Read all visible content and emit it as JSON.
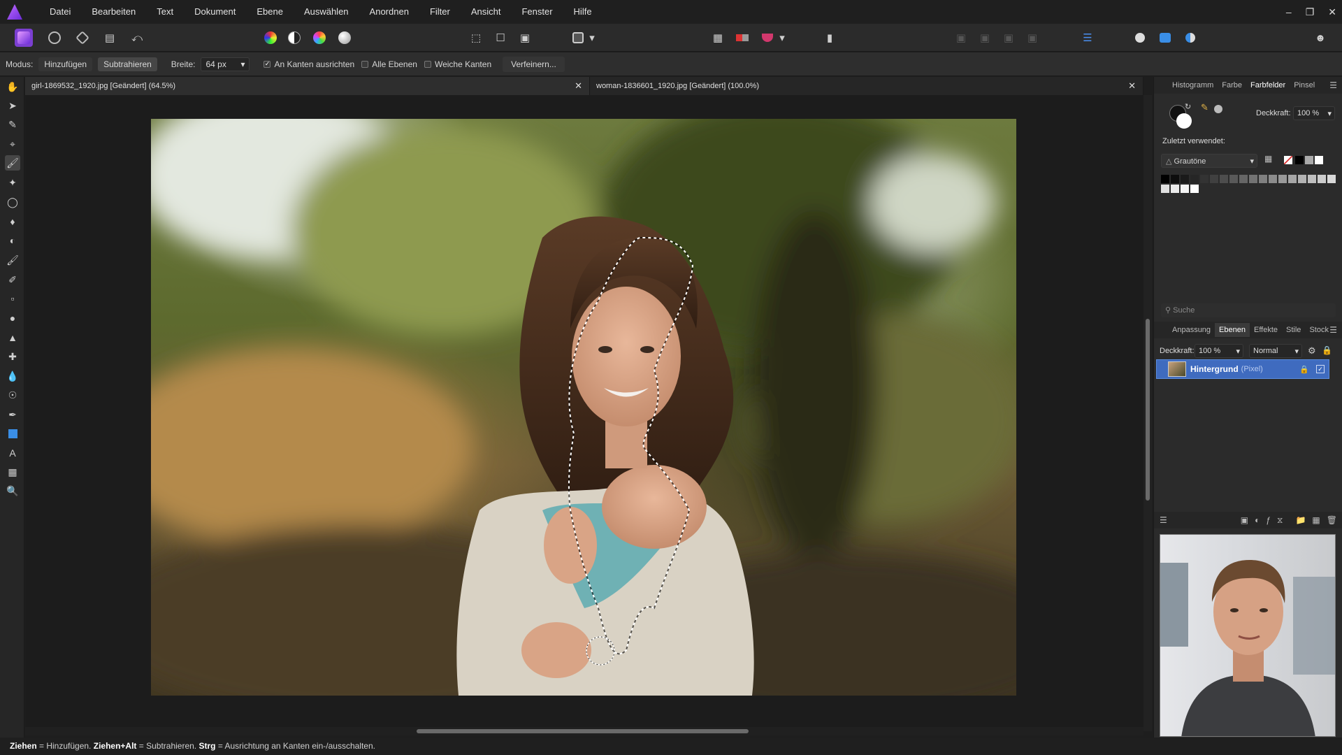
{
  "app": {
    "menu": [
      "Datei",
      "Bearbeiten",
      "Text",
      "Dokument",
      "Ebene",
      "Auswählen",
      "Anordnen",
      "Filter",
      "Ansicht",
      "Fenster",
      "Hilfe"
    ]
  },
  "context_bar": {
    "mode_label": "Modus:",
    "add_label": "Hinzufügen",
    "subtract_label": "Subtrahieren",
    "width_label": "Breite:",
    "width_value": "64 px",
    "snap_edges_label": "An Kanten ausrichten",
    "snap_edges_checked": true,
    "all_layers_label": "Alle Ebenen",
    "all_layers_checked": false,
    "soft_edges_label": "Weiche Kanten",
    "soft_edges_checked": false,
    "refine_label": "Verfeinern..."
  },
  "tabs": [
    {
      "label": "girl-1869532_1920.jpg [Geändert] (64.5%)"
    },
    {
      "label": "woman-1836601_1920.jpg [Geändert] (100.0%)"
    }
  ],
  "swatches_panel": {
    "tabs": [
      "Histogramm",
      "Farbe",
      "Farbfelder",
      "Pinsel"
    ],
    "active_tab": "Farbfelder",
    "opacity_label": "Deckkraft:",
    "opacity_value": "100 %",
    "recent_label": "Zuletzt verwendet:",
    "palette_name": "Grautöne",
    "search_placeholder": "Suche"
  },
  "layers_panel": {
    "tabs": [
      "Anpassung",
      "Ebenen",
      "Effekte",
      "Stile",
      "Stock"
    ],
    "active_tab": "Ebenen",
    "opacity_label": "Deckkraft:",
    "opacity_value": "100 %",
    "blend_mode": "Normal",
    "layer_name": "Hintergrund",
    "layer_type": "(Pixel)"
  },
  "status": {
    "drag": "Ziehen",
    "drag_desc": " = Hinzufügen. ",
    "drag_alt": "Ziehen+Alt",
    "drag_alt_desc": " = Subtrahieren. ",
    "ctrl": "Strg",
    "ctrl_desc": " = Ausrichtung an Kanten ein-/ausschalten."
  },
  "colors": {
    "accent": "#3f6bbf",
    "layer_border": "#5a8de0"
  }
}
